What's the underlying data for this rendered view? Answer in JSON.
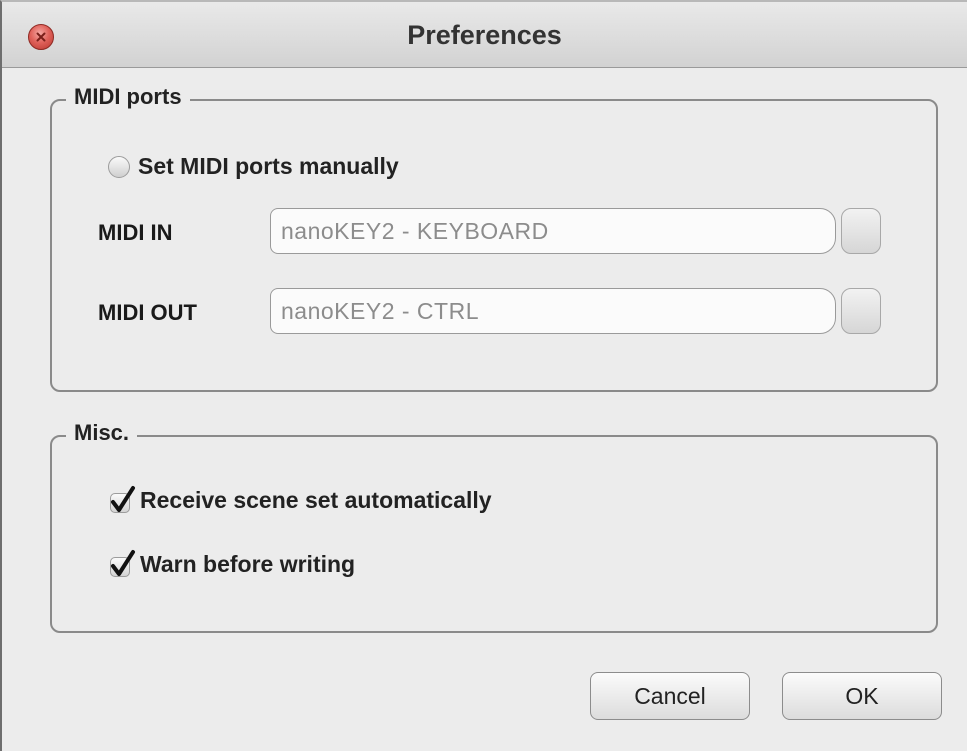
{
  "window": {
    "title": "Preferences"
  },
  "midi_ports": {
    "group_label": "MIDI ports",
    "manual_checkbox": {
      "label": "Set MIDI ports manually",
      "checked": false
    },
    "midi_in": {
      "label": "MIDI IN",
      "value": "nanoKEY2 - KEYBOARD"
    },
    "midi_out": {
      "label": "MIDI OUT",
      "value": "nanoKEY2 - CTRL"
    }
  },
  "misc": {
    "group_label": "Misc.",
    "receive_scene": {
      "label": "Receive scene set automatically",
      "checked": true
    },
    "warn_before_writing": {
      "label": "Warn before writing",
      "checked": true
    }
  },
  "buttons": {
    "cancel": "Cancel",
    "ok": "OK"
  },
  "colors": {
    "close_button": "#e0625b",
    "window_bg": "#ececec"
  },
  "icons": {
    "close": "close-icon",
    "checkmark": "checkmark-icon"
  }
}
